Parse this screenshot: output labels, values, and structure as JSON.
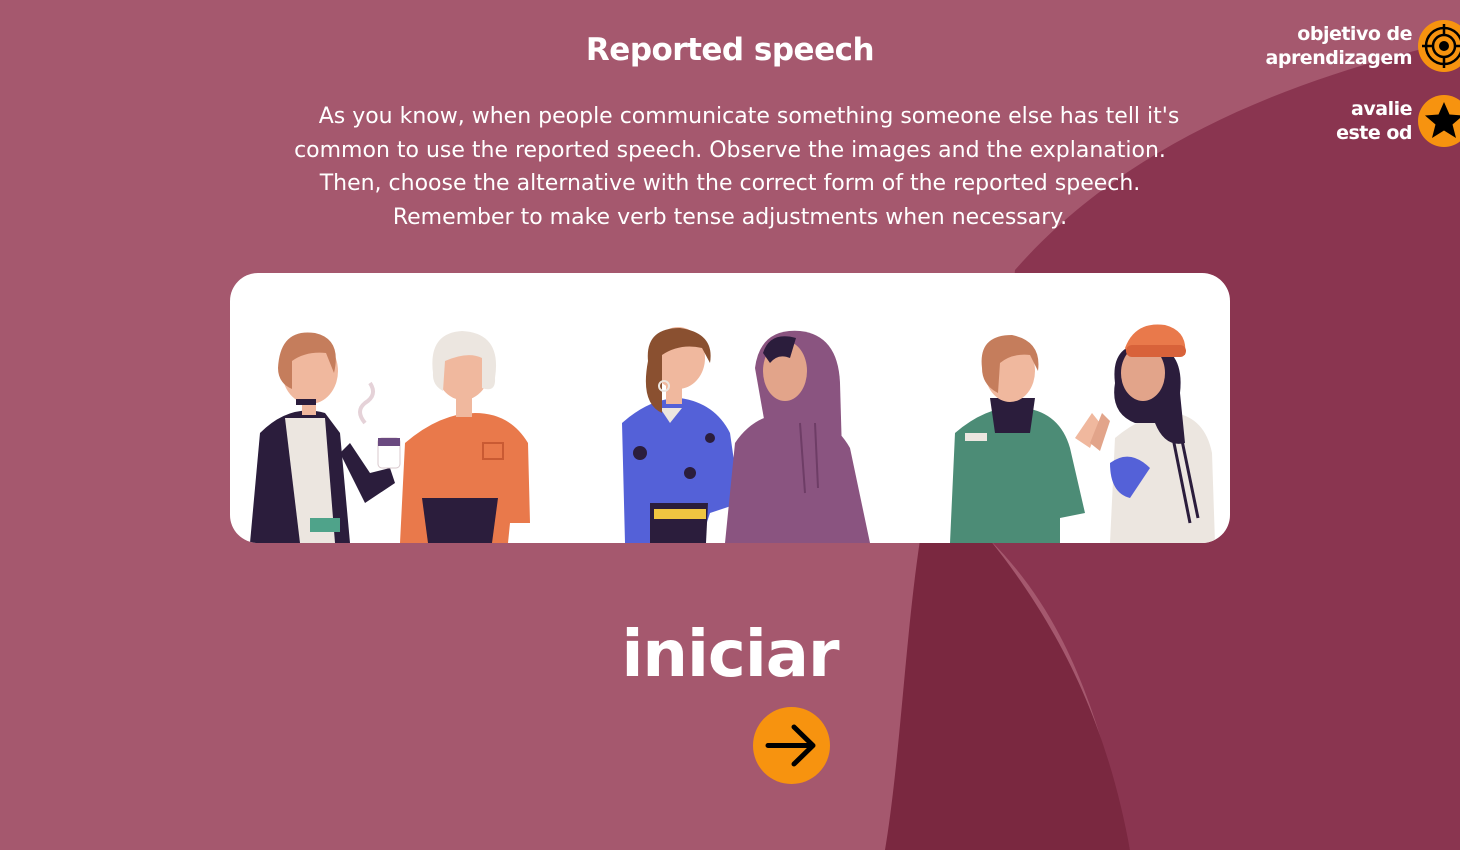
{
  "title": "Reported speech",
  "intro_lines": [
    "As you know, when people communicate something someone else has tell it's",
    "common to use the reported speech. Observe the images and the explanation.",
    "Then, choose the alternative with the correct form of the reported speech.",
    "Remember to make verb tense adjustments when necessary."
  ],
  "start": {
    "label": "iniciar",
    "button_icon": "arrow-right-icon"
  },
  "side_menu": {
    "objective": {
      "line1": "objetivo de",
      "line2": "aprendizagem",
      "icon": "target-icon"
    },
    "rate": {
      "line1": "avalie",
      "line2": "este od",
      "icon": "star-icon"
    }
  },
  "colors": {
    "background": "#a5586e",
    "shape_dark": "#7a2840",
    "shape_mid": "#8a3550",
    "accent": "#f7930f",
    "text": "#ffffff"
  }
}
